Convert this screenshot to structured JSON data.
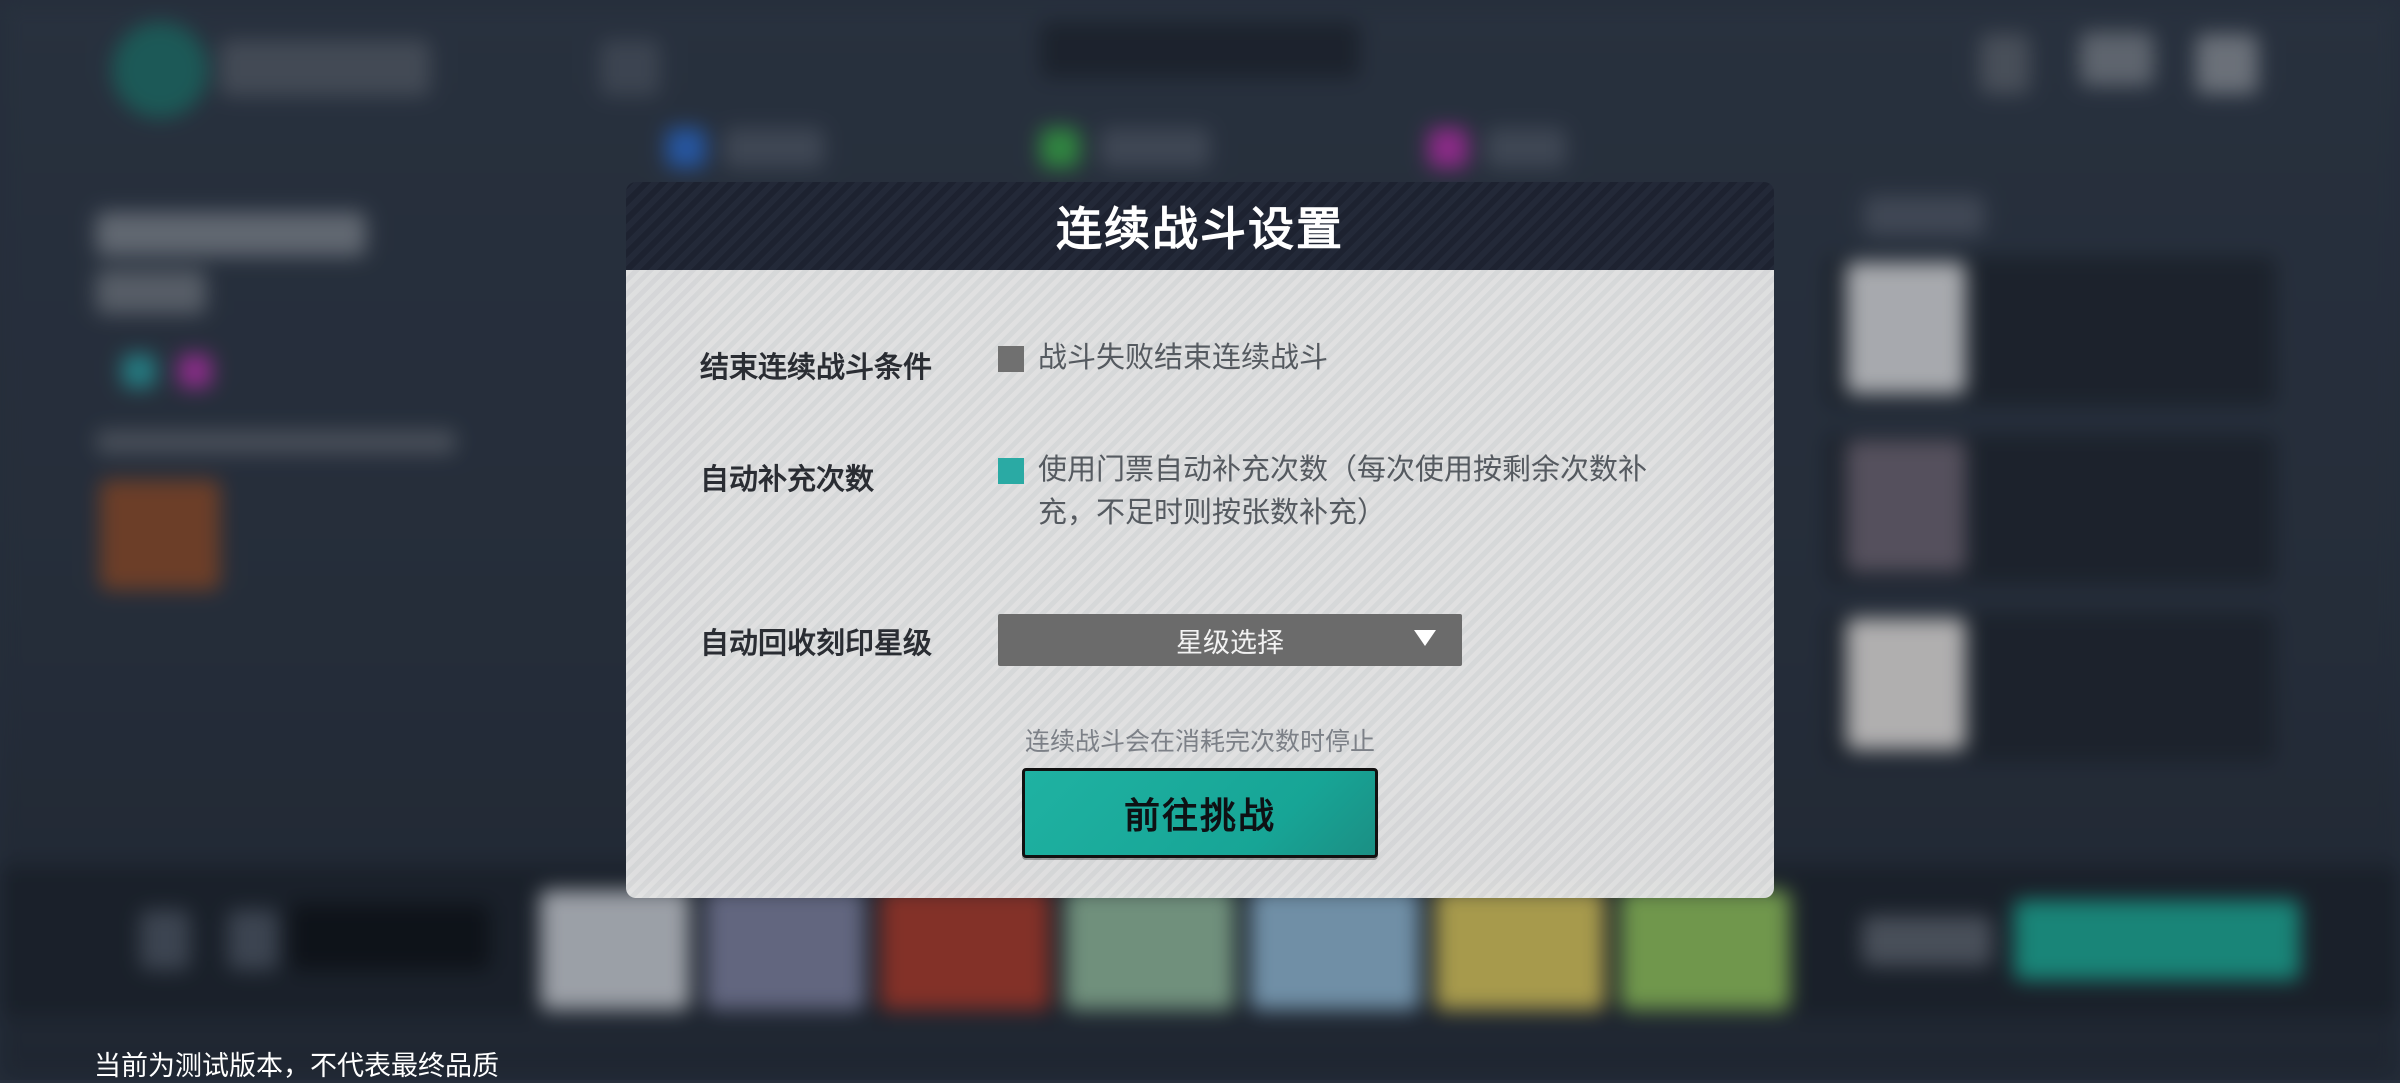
{
  "dialog": {
    "title": "连续战斗设置",
    "rows": [
      {
        "label": "结束连续战斗条件",
        "option": "战斗失败结束连续战斗",
        "checked": false
      },
      {
        "label": "自动补充次数",
        "option": "使用门票自动补充次数（每次使用按剩余次数补充，不足时则按张数补充）",
        "checked": true
      },
      {
        "label": "自动回收刻印星级",
        "dropdown": "星级选择"
      }
    ],
    "notice": "连续战斗会在消耗完次数时停止",
    "confirm_label": "前往挑战"
  },
  "footer": {
    "build_note": "当前为测试版本，不代表最终品质"
  },
  "colors": {
    "accent": "#1fb2a2",
    "checkbox_on": "#2aaaa4",
    "checkbox_off": "#707070",
    "header_bg": "#1d2230",
    "dropdown_bg": "#6b6b6b"
  },
  "icons": {
    "dropdown": "triangle-down-icon"
  }
}
